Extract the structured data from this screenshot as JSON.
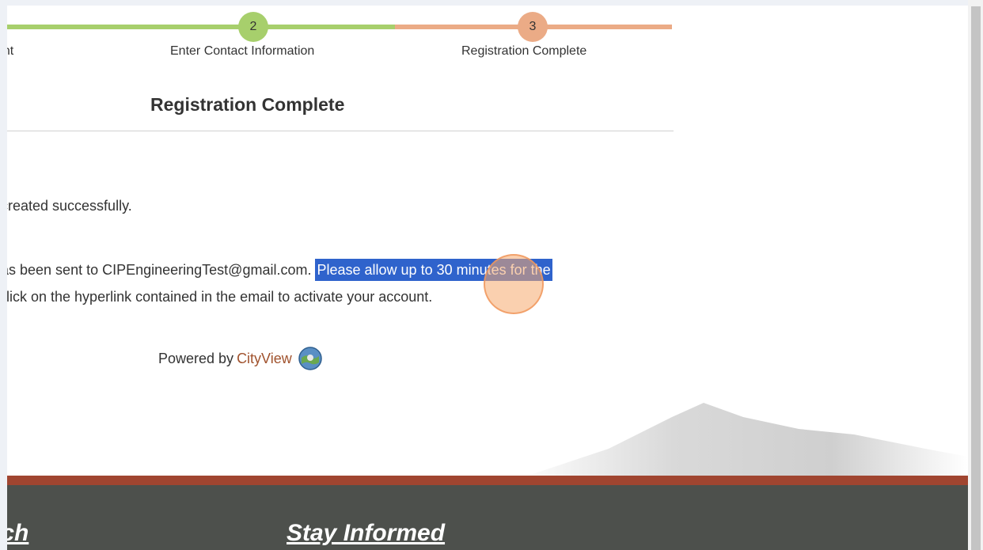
{
  "progress": {
    "steps": [
      {
        "label": "unt"
      },
      {
        "number": "2",
        "label": "Enter Contact Information"
      },
      {
        "number": "3",
        "label": "Registration Complete"
      }
    ],
    "colors": {
      "done": "#a7cf6c",
      "current": "#ebab86"
    }
  },
  "main": {
    "heading": "Registration Complete",
    "line1": "created successfully.",
    "line2_plain": "as been sent to CIPEngineeringTest@gmail.com. ",
    "line2_highlight": "Please allow up to 30 minutes for the",
    "line3": "click on the hyperlink contained in the email to activate your account."
  },
  "powered": {
    "prefix": "Powered by",
    "link": "CityView",
    "logo_icon": "globe-logo-icon"
  },
  "footer": {
    "heading1": "uch",
    "heading2": "Stay Informed",
    "stripe_color": "#a04530"
  }
}
